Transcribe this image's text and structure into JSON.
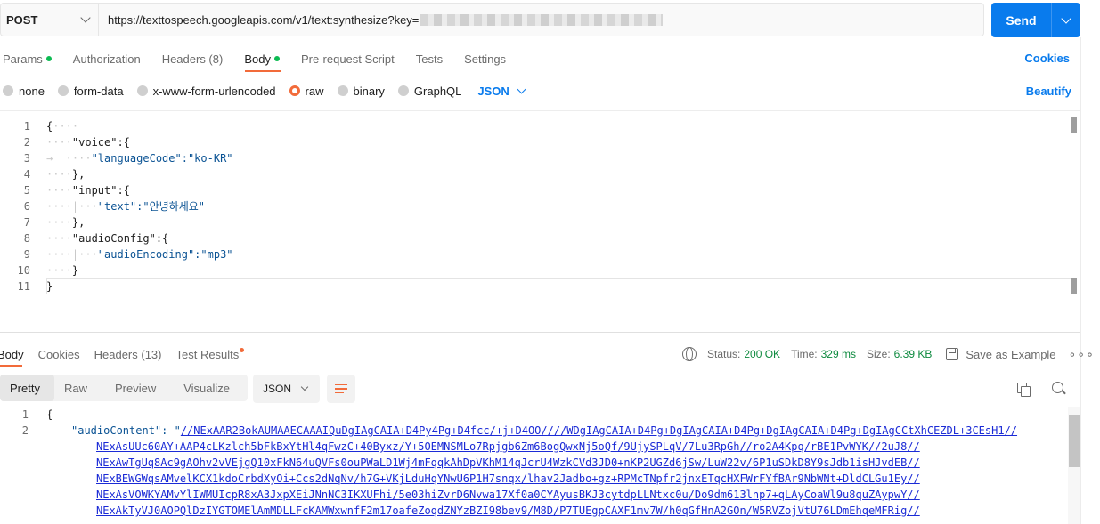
{
  "request": {
    "method": "POST",
    "url": "https://texttospeech.googleapis.com/v1/text:synthesize?key=",
    "send_label": "Send"
  },
  "tabs": [
    {
      "label": "Params",
      "dot": true
    },
    {
      "label": "Authorization",
      "dot": false
    },
    {
      "label": "Headers (8)",
      "dot": false
    },
    {
      "label": "Body",
      "dot": true,
      "active": true
    },
    {
      "label": "Pre-request Script",
      "dot": false
    },
    {
      "label": "Tests",
      "dot": false
    },
    {
      "label": "Settings",
      "dot": false
    }
  ],
  "cookies_label": "Cookies",
  "body_types": [
    {
      "label": "none",
      "selected": false
    },
    {
      "label": "form-data",
      "selected": false
    },
    {
      "label": "x-www-form-urlencoded",
      "selected": false
    },
    {
      "label": "raw",
      "selected": true
    },
    {
      "label": "binary",
      "selected": false
    },
    {
      "label": "GraphQL",
      "selected": false
    }
  ],
  "body_format": "JSON",
  "beautify_label": "Beautify",
  "editor": {
    "line_numbers": [
      "1",
      "2",
      "3",
      "4",
      "5",
      "6",
      "7",
      "8",
      "9",
      "10",
      "11"
    ],
    "lines": [
      {
        "text": "{",
        "ws": ""
      },
      {
        "text": "\"voice\":{",
        "ws": "····"
      },
      {
        "text": "\"languageCode\":\"ko-KR\"",
        "ws": "→  ····"
      },
      {
        "text": "},",
        "ws": "····"
      },
      {
        "text": "\"input\":{",
        "ws": "····"
      },
      {
        "text": "\"text\":\"안녕하세요\"",
        "ws": "····|···"
      },
      {
        "text": "},",
        "ws": "····"
      },
      {
        "text": "\"audioConfig\":{",
        "ws": "····"
      },
      {
        "text": "\"audioEncoding\":\"mp3\"",
        "ws": "····|···"
      },
      {
        "text": "}",
        "ws": "····"
      },
      {
        "text": "}",
        "ws": ""
      }
    ]
  },
  "response": {
    "tabs": [
      {
        "label": "Body",
        "active": true
      },
      {
        "label": "Cookies"
      },
      {
        "label": "Headers (13)"
      },
      {
        "label": "Test Results",
        "dot": true
      }
    ],
    "status_label": "Status:",
    "status_value": "200 OK",
    "time_label": "Time:",
    "time_value": "329 ms",
    "size_label": "Size:",
    "size_value": "6.39 KB",
    "save_label": "Save as Example",
    "more_label": "∘∘∘",
    "views": [
      "Pretty",
      "Raw",
      "Preview",
      "Visualize"
    ],
    "active_view": "Pretty",
    "format": "JSON",
    "line_numbers": [
      "1",
      "2"
    ],
    "line1": "{",
    "key": "\"audioContent\": \"",
    "first_value": "//NExAAR2BokAUMAAECAAAIQuDgIAgCAIA+D4Py4Pg+D4fcc/+j+D4OO////WDgIAgCAIA+D4Pg+DgIAgCAIA+D4Pg+DgIAgCAIA+D4Pg+DgIAgCCtXhCEZDL+3CEsH1//",
    "continuation": [
      "NExAsUUc60AY+AAP4cLKzlch5bFkBxYtHl4qFwzC+40Byxz/Y+5OEMNSMLo7Rpjgb6Zm6BogQwxNj5oQf/9UjySPLqV/7Lu3RpGh//ro2A4Kpq/rBE1PvWYK//2uJ8//",
      "NExAwTgUq8Ac9gAOhv2vVEjgQ10xFkN64uQVFs0ouPWaLD1Wj4mFqqkAhDpVKhM14qJcrU4WzkCVd3JD0+nKP2UGZd6jSw/LuW22v/6P1uSDkD8Y9sJdb1isHJvdEB//",
      "NExBEWGWqsAMvelKCX1kdoCrbdXyOi+Ccs2dNqNv/h7G+VKjLduHqYNwU6P1H7snqx/lhav2Jadbo+gz+RPMcTNpfr2jnxETqcHXFWrFYfBAr9NbWNt+DldCLGu1Ey//",
      "NExAsVOWKYAMvYlIWMUIcpR8xA3JxpXEiJNnNC3IKXUFhi/5e03hiZvrD6Nvwa17Xf0a0CYAyusBKJ3cytdpLLNtxc0u/Do9dm613lnp7+qLAyCoaWl9u8quZAypwY//",
      "NExAkTyVJ0AOPQlDzIYGTOMElAmMDLLFcKAMWxwnfF2m17oafeZoqdZNYzBZI98bev9/M8D/P7TUEgpCAXF1mv7W/h0qGfHnA2GOn/W5RVZojVtU76LDmEhqeMFRig//"
    ]
  },
  "colors": {
    "accent": "#097bed",
    "orange": "#f26b3a",
    "green": "#0cbb52",
    "status_green": "#0e8a3f"
  }
}
